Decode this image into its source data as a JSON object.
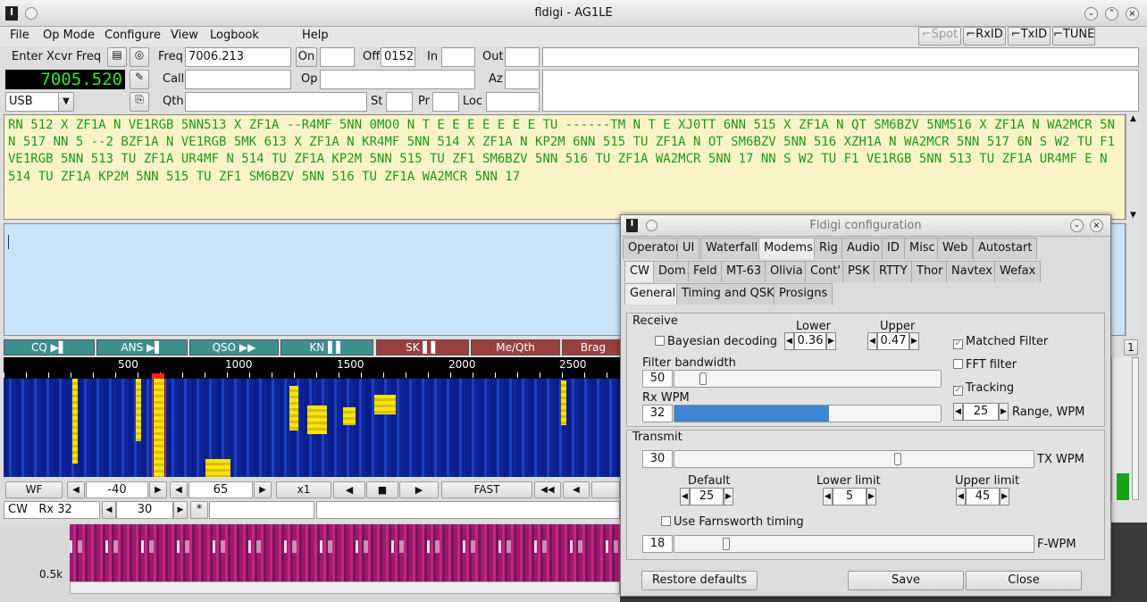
{
  "window": {
    "title": "fldigi - AG1LE"
  },
  "menu": [
    "File",
    "Op Mode",
    "Configure",
    "View",
    "Logbook",
    "Help"
  ],
  "toggles": {
    "spot": "Spot",
    "rxid": "RxID",
    "txid": "TxID",
    "tune": "TUNE"
  },
  "xcvr": {
    "enter_label": "Enter Xcvr Freq",
    "freq_display": "7005.520",
    "mode": "USB",
    "freq_label": "Freq",
    "freq_value": "7006.213",
    "on_label": "On",
    "on_value": "",
    "off_label": "Off",
    "off_value": "0152",
    "in_label": "In",
    "in_value": "",
    "out_label": "Out",
    "out_value": "",
    "call_label": "Call",
    "call_value": "",
    "op_label": "Op",
    "op_value": "",
    "az_label": "Az",
    "az_value": "",
    "qth_label": "Qth",
    "qth_value": "",
    "st_label": "St",
    "st_value": "",
    "pr_label": "Pr",
    "pr_value": "",
    "loc_label": "Loc",
    "loc_value": ""
  },
  "rx_text": "RN 512 X ZF1A N VE1RGB 5NN513 X ZF1A --R4MF 5NN 0MO0 N T E E E E E E E TU ------TM N T E XJ0TT 6NN 515 X ZF1A N QT SM6BZV 5NM516 X ZF1A N WA2MCR 5NN 517 NN 5 --2 BZF1A N VE1RGB 5MK 613 X ZF1A N KR4MF 5NN 514 X ZF1A N KP2M 6NN 515 TU ZF1A N OT SM6BZV 5NN 516 XZH1A N WA2MCR 5NN 517 6N S W2 TU F1 VE1RGB 5NN 513 TU ZF1A UR4MF N 514 TU ZF1A KP2M 5NN 515 TU ZF1 SM6BZV 5NN 516 TU ZF1A WA2MCR 5NN 17 NN S W2 TU F1 VE1RGB 5NN 513 TU ZF1A UR4MF E N 514 TU ZF1A KP2M 5NN 515 TU ZF1 SM6BZV 5NN 516 TU ZF1A WA2MCR 5NN 17",
  "macros": [
    {
      "label": "CQ",
      "color": "#3f8f8f"
    },
    {
      "label": "ANS",
      "color": "#3f8f8f"
    },
    {
      "label": "QSO",
      "color": "#3f8f8f"
    },
    {
      "label": "KN",
      "color": "#3f8f8f"
    },
    {
      "label": "SK",
      "color": "#9a3f3f"
    },
    {
      "label": "Me/Qth",
      "color": "#9a3f3f"
    },
    {
      "label": "Brag",
      "color": "#9a3f3f"
    }
  ],
  "ruler": [
    "500",
    "1000",
    "1500",
    "2000",
    "2500"
  ],
  "wf_controls": {
    "wf": "WF",
    "ref": "-40",
    "range": "65",
    "zoom": "x1",
    "speed": "FAST"
  },
  "status": {
    "mode": "CW",
    "rx": "Rx 32",
    "sq": "30",
    "star": "*"
  },
  "side_counter": "1",
  "lower_scale": "0.5k",
  "config": {
    "title": "Fldigi configuration",
    "tabs1": [
      "Operator",
      "UI",
      "Waterfall",
      "Modems",
      "Rig",
      "Audio",
      "ID",
      "Misc",
      "Web",
      "Autostart"
    ],
    "tabs2": [
      "CW",
      "Dom",
      "Feld",
      "MT-63",
      "Olivia",
      "Cont'",
      "PSK",
      "RTTY",
      "Thor",
      "Navtex",
      "Wefax"
    ],
    "tabs3": [
      "General",
      "Timing and QSK",
      "Prosigns"
    ],
    "receive": {
      "group": "Receive",
      "bayesian": "Bayesian decoding",
      "lower_label": "Lower",
      "lower_value": "0.36",
      "upper_label": "Upper",
      "upper_value": "0.47",
      "matched": "Matched Filter",
      "fft": "FFT filter",
      "tracking": "Tracking",
      "bw_label": "Filter bandwidth",
      "bw_value": "50",
      "wpm_label": "Rx WPM",
      "wpm_value": "32",
      "wpm_fill": 0.58,
      "range_value": "25",
      "range_label": "Range, WPM"
    },
    "transmit": {
      "group": "Transmit",
      "tx_value": "30",
      "tx_label": "TX WPM",
      "default_label": "Default",
      "default_value": "25",
      "lower_label": "Lower limit",
      "lower_value": "5",
      "upper_label": "Upper limit",
      "upper_value": "45",
      "farnsworth": "Use Farnsworth timing",
      "fwpm_value": "18",
      "fwpm_label": "F-WPM"
    },
    "buttons": {
      "restore": "Restore defaults",
      "save": "Save",
      "close": "Close"
    }
  }
}
